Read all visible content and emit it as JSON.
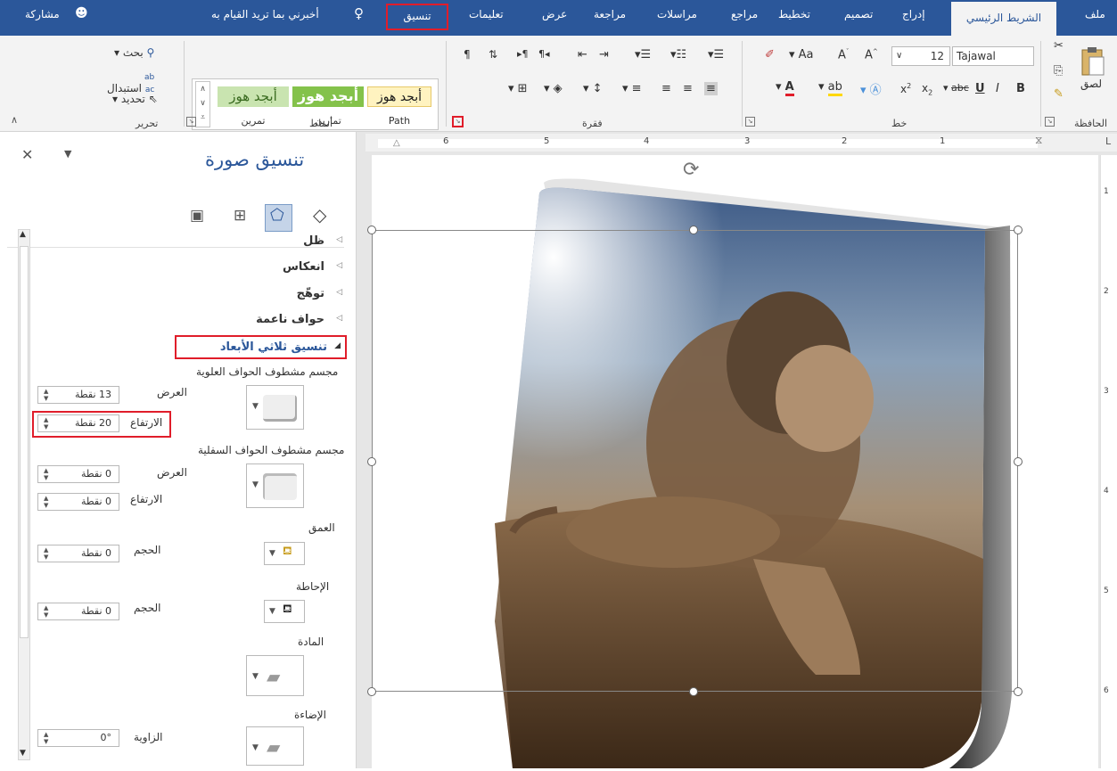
{
  "tabs": {
    "file": "ملف",
    "home": "الشريط الرئيسي",
    "insert": "إدراج",
    "design": "تصميم",
    "layout": "تخطيط",
    "references": "مراجع",
    "mailings": "مراسلات",
    "review": "مراجعة",
    "view": "عرض",
    "help": "تعليمات",
    "format": "تنسيق",
    "tell_me": "أخبرني بما تريد القيام به",
    "share": "مشاركة"
  },
  "ribbon": {
    "clipboard": {
      "label": "الحافظة",
      "paste": "لصق"
    },
    "font": {
      "label": "خط",
      "font_name": "Tajawal",
      "font_size": "12"
    },
    "paragraph": {
      "label": "فقرة"
    },
    "styles": {
      "label": "أنماط",
      "items": [
        {
          "preview": "أبجد هوز",
          "name": "Path"
        },
        {
          "preview": "أبجد هوز",
          "name": "تمارين"
        },
        {
          "preview": "أبجد هوز",
          "name": "تمرين"
        }
      ]
    },
    "editing": {
      "label": "تحرير",
      "find": "بحث",
      "replace": "استبدال",
      "select": "تحديد"
    }
  },
  "pane": {
    "title": "تنسيق صورة",
    "sections": {
      "shadow": "ظل",
      "reflection": "انعكاس",
      "glow": "توهّج",
      "soft_edges": "حواف ناعمة",
      "format_3d": "تنسيق ثلاثي الأبعاد"
    },
    "top_bevel": {
      "label": "مجسم مشطوف الحواف العلوية",
      "width_label": "العرض",
      "width_value": "13 نقطة",
      "height_label": "الارتفاع",
      "height_value": "20 نقطة"
    },
    "bottom_bevel": {
      "label": "مجسم مشطوف الحواف السفلية",
      "width_label": "العرض",
      "width_value": "0 نقطة",
      "height_label": "الارتفاع",
      "height_value": "0 نقطة"
    },
    "depth": {
      "label": "العمق",
      "size_label": "الحجم",
      "size_value": "0 نقطة"
    },
    "contour": {
      "label": "الإحاطة",
      "size_label": "الحجم",
      "size_value": "0 نقطة"
    },
    "material": {
      "label": "المادة"
    },
    "lighting": {
      "label": "الإضاءة",
      "angle_label": "الزاوية",
      "angle_value": "0°"
    }
  },
  "ruler": {
    "numbers": [
      "6",
      "5",
      "4",
      "3",
      "2",
      "1"
    ],
    "vnumbers": [
      "1",
      "2",
      "3",
      "4",
      "5",
      "6"
    ]
  },
  "colors": {
    "accent": "#2b579a",
    "highlight": "#e01d2a",
    "ribbon_bg": "#f3f3f3"
  }
}
